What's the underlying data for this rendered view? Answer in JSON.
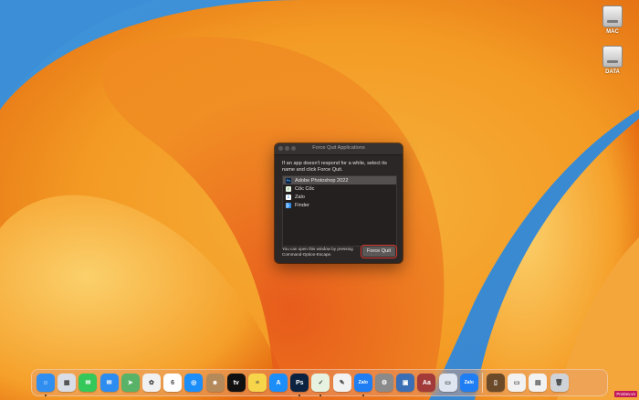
{
  "desktop": {
    "icons": [
      {
        "label": "MAC"
      },
      {
        "label": "DATA"
      }
    ]
  },
  "dialog": {
    "title": "Force Quit Applications",
    "description": "If an app doesn't respond for a while, select its name and click Force Quit.",
    "apps": [
      {
        "name": "Adobe Photoshop 2022",
        "icon": "photoshop-icon",
        "selected": true
      },
      {
        "name": "Cốc Cốc",
        "icon": "coccoc-icon",
        "selected": false
      },
      {
        "name": "Zalo",
        "icon": "zalo-icon",
        "selected": false
      },
      {
        "name": "Finder",
        "icon": "finder-icon",
        "selected": false
      }
    ],
    "footer_note": "You can open this window by pressing Command-Option-Escape.",
    "force_quit_label": "Force Quit"
  },
  "dock": {
    "items": [
      {
        "name": "finder",
        "glyph": "☺",
        "color": "#2f8ef0",
        "running": true
      },
      {
        "name": "launchpad",
        "glyph": "▦",
        "color": "#d9dde6",
        "running": false
      },
      {
        "name": "messages",
        "glyph": "✉",
        "color": "#34c759",
        "running": false
      },
      {
        "name": "mail",
        "glyph": "✉",
        "color": "#2d8cf0",
        "running": false
      },
      {
        "name": "maps",
        "glyph": "➤",
        "color": "#58b368",
        "running": false
      },
      {
        "name": "photos",
        "glyph": "✿",
        "color": "#f1f1f1",
        "running": false
      },
      {
        "name": "calendar",
        "glyph": "6",
        "color": "#ffffff",
        "running": false
      },
      {
        "name": "safari",
        "glyph": "◎",
        "color": "#1c8ef9",
        "running": false
      },
      {
        "name": "contacts",
        "glyph": "☻",
        "color": "#b58a5a",
        "running": false
      },
      {
        "name": "apple-tv",
        "glyph": "tv",
        "color": "#111111",
        "running": false
      },
      {
        "name": "notes",
        "glyph": "≡",
        "color": "#f7d54a",
        "running": false
      },
      {
        "name": "app-store",
        "glyph": "A",
        "color": "#1c8ef9",
        "running": false
      },
      {
        "name": "photoshop",
        "glyph": "Ps",
        "color": "#0b2340",
        "running": true
      },
      {
        "name": "coccoc",
        "glyph": "✓",
        "color": "#e7f3e0",
        "running": true
      },
      {
        "name": "textedit",
        "glyph": "✎",
        "color": "#f2f2f2",
        "running": false
      },
      {
        "name": "zalo",
        "glyph": "Zalo",
        "color": "#1f7ef3",
        "running": true
      },
      {
        "name": "system-preferences",
        "glyph": "⚙",
        "color": "#8a8a8a",
        "running": false
      },
      {
        "name": "preview",
        "glyph": "▣",
        "color": "#3a6fb5",
        "running": false
      },
      {
        "name": "dictionary",
        "glyph": "Aa",
        "color": "#a33a3a",
        "running": false
      },
      {
        "name": "screen-sharing",
        "glyph": "▭",
        "color": "#dfe6f2",
        "running": false
      },
      {
        "name": "zalo-2",
        "glyph": "Zalo",
        "color": "#1f7ef3",
        "running": false
      },
      {
        "name": "separator",
        "glyph": "",
        "color": "",
        "running": false
      },
      {
        "name": "document",
        "glyph": "▯",
        "color": "#6b4a2a",
        "running": false
      },
      {
        "name": "display",
        "glyph": "▭",
        "color": "#f2f2f2",
        "running": false
      },
      {
        "name": "screenshot",
        "glyph": "▤",
        "color": "#f2f2f2",
        "running": false
      },
      {
        "name": "trash",
        "glyph": "🗑",
        "color": "#cfd3d8",
        "running": false
      }
    ]
  },
  "watermark": "ProDev.vn",
  "colors": {
    "dialog_bg": "#2c2727",
    "selected_row": "#555050",
    "button_outline": "#d43a2e"
  }
}
